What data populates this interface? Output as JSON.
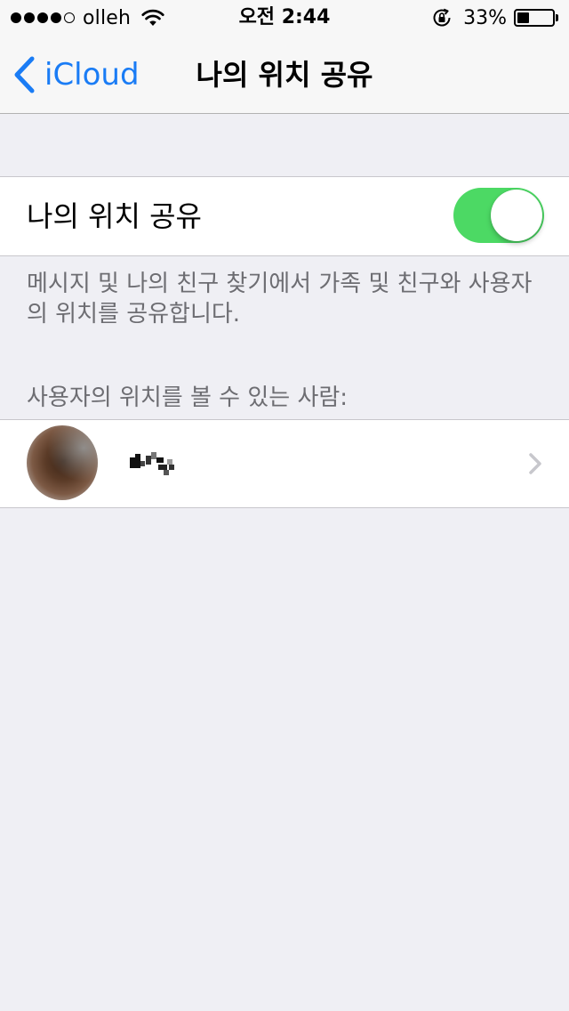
{
  "status_bar": {
    "carrier": "olleh",
    "signal_filled": 4,
    "signal_total": 5,
    "time": "오전 2:44",
    "battery_percent_text": "33%",
    "battery_level": 0.33
  },
  "nav": {
    "back_label": "iCloud",
    "title": "나의 위치 공유",
    "accent_color": "#1a7cf5"
  },
  "share_toggle": {
    "label": "나의 위치 공유",
    "on": true,
    "on_color": "#4cd964"
  },
  "footer_text": "메시지 및 나의 친구 찾기에서 가족 및 친구와 사용자의 위치를 공유합니다.",
  "section_header": "사용자의 위치를 볼 수 있는 사람:",
  "people": [
    {
      "name_redacted": true,
      "icon": "avatar-photo"
    }
  ],
  "icons": {
    "wifi": "wifi-icon",
    "rotation_lock": "rotation-lock-icon",
    "battery": "battery-icon",
    "back": "chevron-left-icon",
    "disclosure": "chevron-right-icon"
  }
}
